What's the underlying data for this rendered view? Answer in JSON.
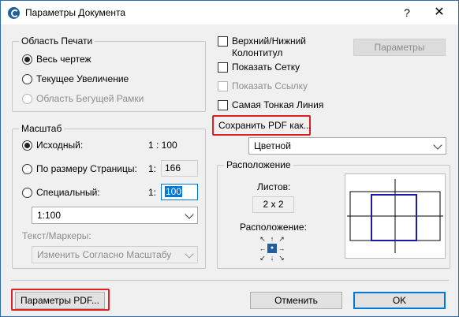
{
  "window": {
    "title": "Параметры Документа",
    "help_label": "?",
    "close_label": "✕"
  },
  "print_area": {
    "title": "Область Печати",
    "options": [
      {
        "label": "Весь чертеж",
        "checked": true,
        "disabled": false
      },
      {
        "label": "Текущее Увеличение",
        "checked": false,
        "disabled": false
      },
      {
        "label": "Область Бегущей Рамки",
        "checked": false,
        "disabled": true
      }
    ]
  },
  "scale": {
    "title": "Масштаб",
    "original_label": "Исходный:",
    "original_value": "1 : 100",
    "fit_label": "По размеру Страницы:",
    "fit_prefix": "1:",
    "fit_value": "166",
    "custom_label": "Специальный:",
    "custom_prefix": "1:",
    "custom_value": "100",
    "scale_dropdown": "1:100",
    "text_markers_label": "Текст/Маркеры:",
    "text_markers_value": "Изменить Согласно Масштабу"
  },
  "options": {
    "header_footer_label": "Верхний/Нижний Колонтитул",
    "header_footer_button": "Параметры",
    "show_grid_label": "Показать Сетку",
    "show_reference_label": "Показать Ссылку",
    "thinnest_line_label": "Самая Тонкая Линия",
    "save_pdf_as_label": "Сохранить PDF как...",
    "color_mode": "Цветной"
  },
  "placement": {
    "title": "Расположение",
    "sheets_label": "Листов:",
    "sheets_value": "2 x 2",
    "position_label": "Расположение:"
  },
  "footer": {
    "pdf_params_label": "Параметры PDF...",
    "cancel_label": "Отменить",
    "ok_label": "OK"
  },
  "colors": {
    "highlight_frame": "#e02020",
    "accent": "#0078d7",
    "preview_page": "#1a1aa6"
  },
  "icons": {
    "app": "archicad-icon",
    "position_arrows": [
      "↖",
      "↑",
      "↗",
      "←",
      "●",
      "→",
      "↙",
      "↓",
      "↘"
    ]
  }
}
